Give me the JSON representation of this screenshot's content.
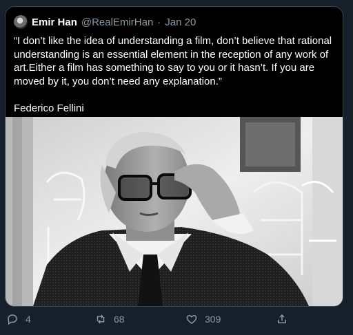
{
  "tweet": {
    "display_name": "Emir Han",
    "handle": "@RealEmirHan",
    "separator": "·",
    "date": "Jan 20",
    "text": "“I don’t like the idea of understanding a film, don’t believe that rational\nunderstanding is an essential element in the reception of any work of\nart.Either a film has something to say to you or it hasn’t. If you are\nmoved by it, you don’t need any explanation.”",
    "author": "Federico Fellini",
    "image_icon": "photo"
  },
  "actions": {
    "reply_count": "4",
    "retweet_count": "68",
    "like_count": "309",
    "reply_icon": "reply-icon",
    "retweet_icon": "retweet-icon",
    "like_icon": "heart-icon",
    "share_icon": "share-icon"
  },
  "colors": {
    "background": "#15202b",
    "card": "#000000",
    "muted": "#8899a6",
    "text": "#ffffff"
  }
}
